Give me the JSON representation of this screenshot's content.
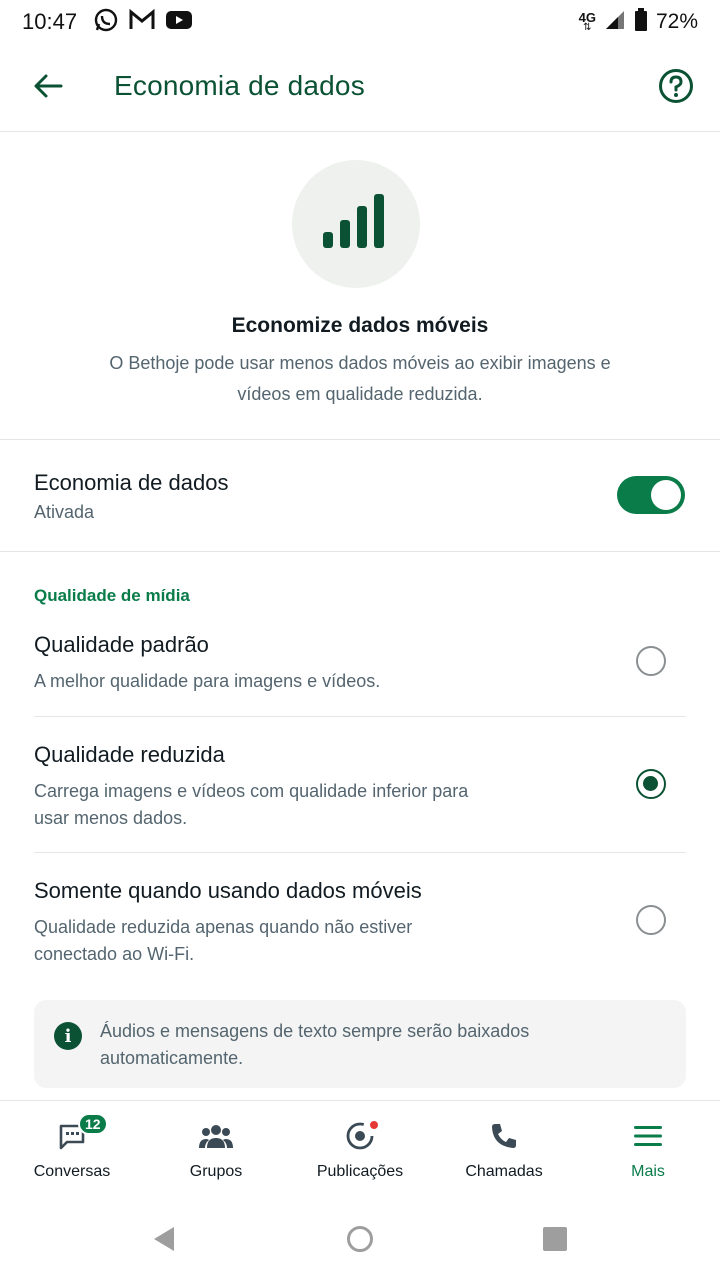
{
  "status_bar": {
    "time": "10:47",
    "network": "4G",
    "battery": "72%",
    "icons": [
      "whatsapp-icon",
      "gmail-icon",
      "youtube-icon",
      "signal-icon",
      "battery-icon"
    ]
  },
  "app_bar": {
    "title": "Economia de dados",
    "icons": [
      "back-arrow-icon",
      "help-icon"
    ]
  },
  "hero": {
    "title": "Economize dados móveis",
    "description": "O Bethoje pode usar menos dados móveis ao exibir imagens e vídeos em qualidade reduzida.",
    "icon": "signal-bars-icon"
  },
  "data_saver": {
    "title": "Economia de dados",
    "status": "Ativada",
    "enabled": true
  },
  "media_quality": {
    "section_label": "Qualidade de mídia",
    "options": [
      {
        "title": "Qualidade padrão",
        "description": "A melhor qualidade para imagens e vídeos.",
        "selected": false
      },
      {
        "title": "Qualidade reduzida",
        "description": "Carrega imagens e vídeos com qualidade inferior para usar menos dados.",
        "selected": true
      },
      {
        "title": "Somente quando usando dados móveis",
        "description": "Qualidade reduzida apenas quando não estiver conectado ao Wi-Fi.",
        "selected": false
      }
    ]
  },
  "info": {
    "icon_glyph": "i",
    "text": "Áudios e mensagens de texto sempre serão baixados automaticamente."
  },
  "bottom_nav": {
    "items": [
      {
        "label": "Conversas",
        "icon": "chat-icon",
        "badge": "12"
      },
      {
        "label": "Grupos",
        "icon": "groups-icon"
      },
      {
        "label": "Publicações",
        "icon": "publications-icon"
      },
      {
        "label": "Chamadas",
        "icon": "phone-icon"
      },
      {
        "label": "Mais",
        "icon": "menu-icon",
        "active": true
      }
    ]
  },
  "colors": {
    "accent": "#0a7c4a",
    "accent_dark": "#0b5234",
    "text_secondary": "#54656f"
  }
}
